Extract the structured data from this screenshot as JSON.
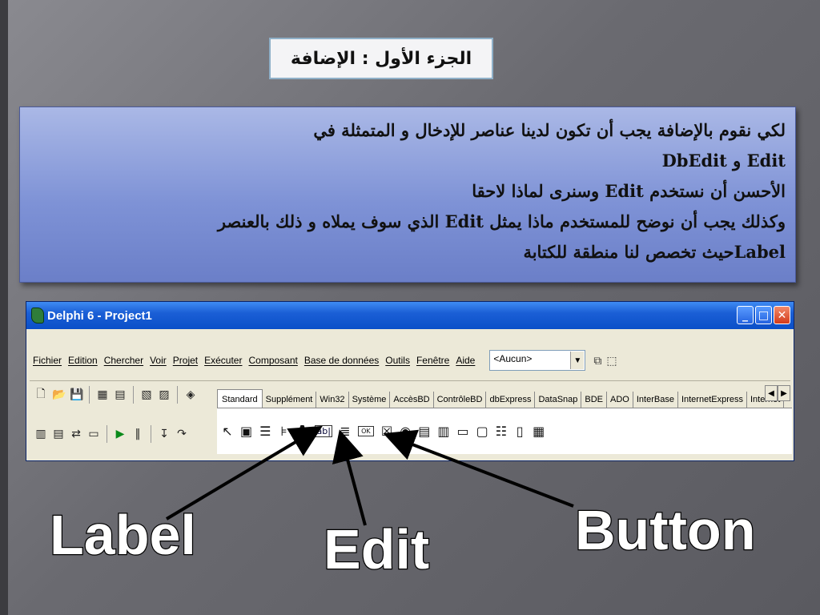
{
  "slide": {
    "title": "الجزء الأول : الإضافة",
    "paragraph_lines": [
      "لكي نقوم بالإضافة يجب أن تكون لدينا عناصر للإدخال و المتمثلة في",
      "Edit و DbEdit",
      "الأحسن أن نستخدم Edit وسنرى لماذا لاحقا",
      "وكذلك يجب أن نوضح للمستخدم ماذا يمثل Edit  الذي سوف يملاه و ذلك بالعنصر",
      "Labelحيث تخصص لنا منطقة للكتابة"
    ]
  },
  "window": {
    "title": "Delphi 6 - Project1",
    "menu": [
      "Fichier",
      "Edition",
      "Chercher",
      "Voir",
      "Projet",
      "Exécuter",
      "Composant",
      "Base de données",
      "Outils",
      "Fenêtre",
      "Aide"
    ],
    "combo_value": "<Aucun>",
    "tabs": [
      "Standard",
      "Supplément",
      "Win32",
      "Système",
      "AccèsBD",
      "ContrôleBD",
      "dbExpress",
      "DataSnap",
      "BDE",
      "ADO",
      "InterBase",
      "InternetExpress",
      "Internet"
    ],
    "active_tab": "Standard"
  },
  "annotations": {
    "label": "Label",
    "edit": "Edit",
    "button": "Button"
  }
}
